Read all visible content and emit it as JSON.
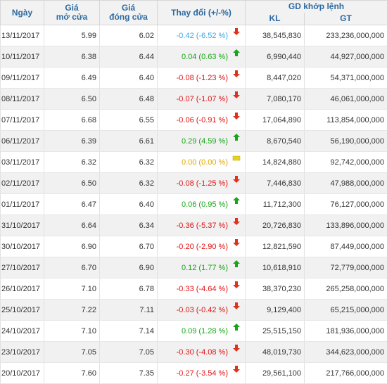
{
  "headers": {
    "date": "Ngày",
    "open_line1": "Giá",
    "open_line2": "mở cửa",
    "close_line1": "Giá",
    "close_line2": "đóng cửa",
    "change": "Thay đổi (+/-%)",
    "gd": "GD khớp lệnh",
    "kl": "KL",
    "gt": "GT"
  },
  "colors": {
    "up": "#19a519",
    "down": "#e01414",
    "reference": "#e0a800",
    "flat_blue": "#3aa6e2",
    "header_text": "#2d6aa1"
  },
  "rows": [
    {
      "date": "13/11/2017",
      "open": "5.99",
      "close": "6.02",
      "change": "-0.42 (-6.52 %)",
      "dir": "flat",
      "kl": "38,545,830",
      "gt": "233,236,000,000",
      "icon": "arrow-down-icon"
    },
    {
      "date": "10/11/2017",
      "open": "6.38",
      "close": "6.44",
      "change": "0.04 (0.63 %)",
      "dir": "up",
      "kl": "6,990,440",
      "gt": "44,927,000,000",
      "icon": "arrow-up-icon"
    },
    {
      "date": "09/11/2017",
      "open": "6.49",
      "close": "6.40",
      "change": "-0.08 (-1.23 %)",
      "dir": "down",
      "kl": "8,447,020",
      "gt": "54,371,000,000",
      "icon": "arrow-down-icon"
    },
    {
      "date": "08/11/2017",
      "open": "6.50",
      "close": "6.48",
      "change": "-0.07 (-1.07 %)",
      "dir": "down",
      "kl": "7,080,170",
      "gt": "46,061,000,000",
      "icon": "arrow-down-icon"
    },
    {
      "date": "07/11/2017",
      "open": "6.68",
      "close": "6.55",
      "change": "-0.06 (-0.91 %)",
      "dir": "down",
      "kl": "17,064,890",
      "gt": "113,854,000,000",
      "icon": "arrow-down-icon"
    },
    {
      "date": "06/11/2017",
      "open": "6.39",
      "close": "6.61",
      "change": "0.29 (4.59 %)",
      "dir": "up",
      "kl": "8,670,540",
      "gt": "56,190,000,000",
      "icon": "arrow-up-icon"
    },
    {
      "date": "03/11/2017",
      "open": "6.32",
      "close": "6.32",
      "change": "0.00 (0.00 %)",
      "dir": "ref",
      "kl": "14,824,880",
      "gt": "92,742,000,000",
      "icon": "no-change-icon"
    },
    {
      "date": "02/11/2017",
      "open": "6.50",
      "close": "6.32",
      "change": "-0.08 (-1.25 %)",
      "dir": "down",
      "kl": "7,446,830",
      "gt": "47,988,000,000",
      "icon": "arrow-down-icon"
    },
    {
      "date": "01/11/2017",
      "open": "6.47",
      "close": "6.40",
      "change": "0.06 (0.95 %)",
      "dir": "up",
      "kl": "11,712,300",
      "gt": "76,127,000,000",
      "icon": "arrow-up-icon"
    },
    {
      "date": "31/10/2017",
      "open": "6.64",
      "close": "6.34",
      "change": "-0.36 (-5.37 %)",
      "dir": "down",
      "kl": "20,726,830",
      "gt": "133,896,000,000",
      "icon": "arrow-down-icon"
    },
    {
      "date": "30/10/2017",
      "open": "6.90",
      "close": "6.70",
      "change": "-0.20 (-2.90 %)",
      "dir": "down",
      "kl": "12,821,590",
      "gt": "87,449,000,000",
      "icon": "arrow-down-icon"
    },
    {
      "date": "27/10/2017",
      "open": "6.70",
      "close": "6.90",
      "change": "0.12 (1.77 %)",
      "dir": "up",
      "kl": "10,618,910",
      "gt": "72,779,000,000",
      "icon": "arrow-up-icon"
    },
    {
      "date": "26/10/2017",
      "open": "7.10",
      "close": "6.78",
      "change": "-0.33 (-4.64 %)",
      "dir": "down",
      "kl": "38,370,230",
      "gt": "265,258,000,000",
      "icon": "arrow-down-icon"
    },
    {
      "date": "25/10/2017",
      "open": "7.22",
      "close": "7.11",
      "change": "-0.03 (-0.42 %)",
      "dir": "down",
      "kl": "9,129,400",
      "gt": "65,215,000,000",
      "icon": "arrow-down-icon"
    },
    {
      "date": "24/10/2017",
      "open": "7.10",
      "close": "7.14",
      "change": "0.09 (1.28 %)",
      "dir": "up",
      "kl": "25,515,150",
      "gt": "181,936,000,000",
      "icon": "arrow-up-icon"
    },
    {
      "date": "23/10/2017",
      "open": "7.05",
      "close": "7.05",
      "change": "-0.30 (-4.08 %)",
      "dir": "down",
      "kl": "48,019,730",
      "gt": "344,623,000,000",
      "icon": "arrow-down-icon"
    },
    {
      "date": "20/10/2017",
      "open": "7.60",
      "close": "7.35",
      "change": "-0.27 (-3.54 %)",
      "dir": "down",
      "kl": "29,561,100",
      "gt": "217,766,000,000",
      "icon": "arrow-down-icon"
    }
  ]
}
